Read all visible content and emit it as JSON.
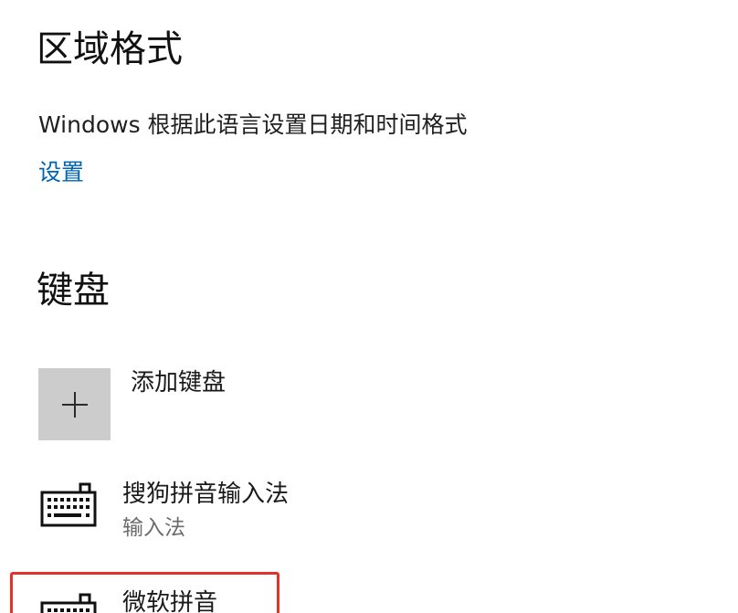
{
  "regional_format": {
    "title": "区域格式",
    "description": "Windows 根据此语言设置日期和时间格式",
    "settings_link": "设置"
  },
  "keyboard": {
    "title": "键盘",
    "add_keyboard_label": "添加键盘",
    "items": [
      {
        "name": "搜狗拼音输入法",
        "type": "输入法",
        "icon": "keyboard-icon"
      },
      {
        "name": "微软拼音",
        "icon": "keyboard-icon"
      }
    ]
  },
  "colors": {
    "link": "#0063b1",
    "tile": "#cccccc",
    "highlight": "#e0342b"
  }
}
